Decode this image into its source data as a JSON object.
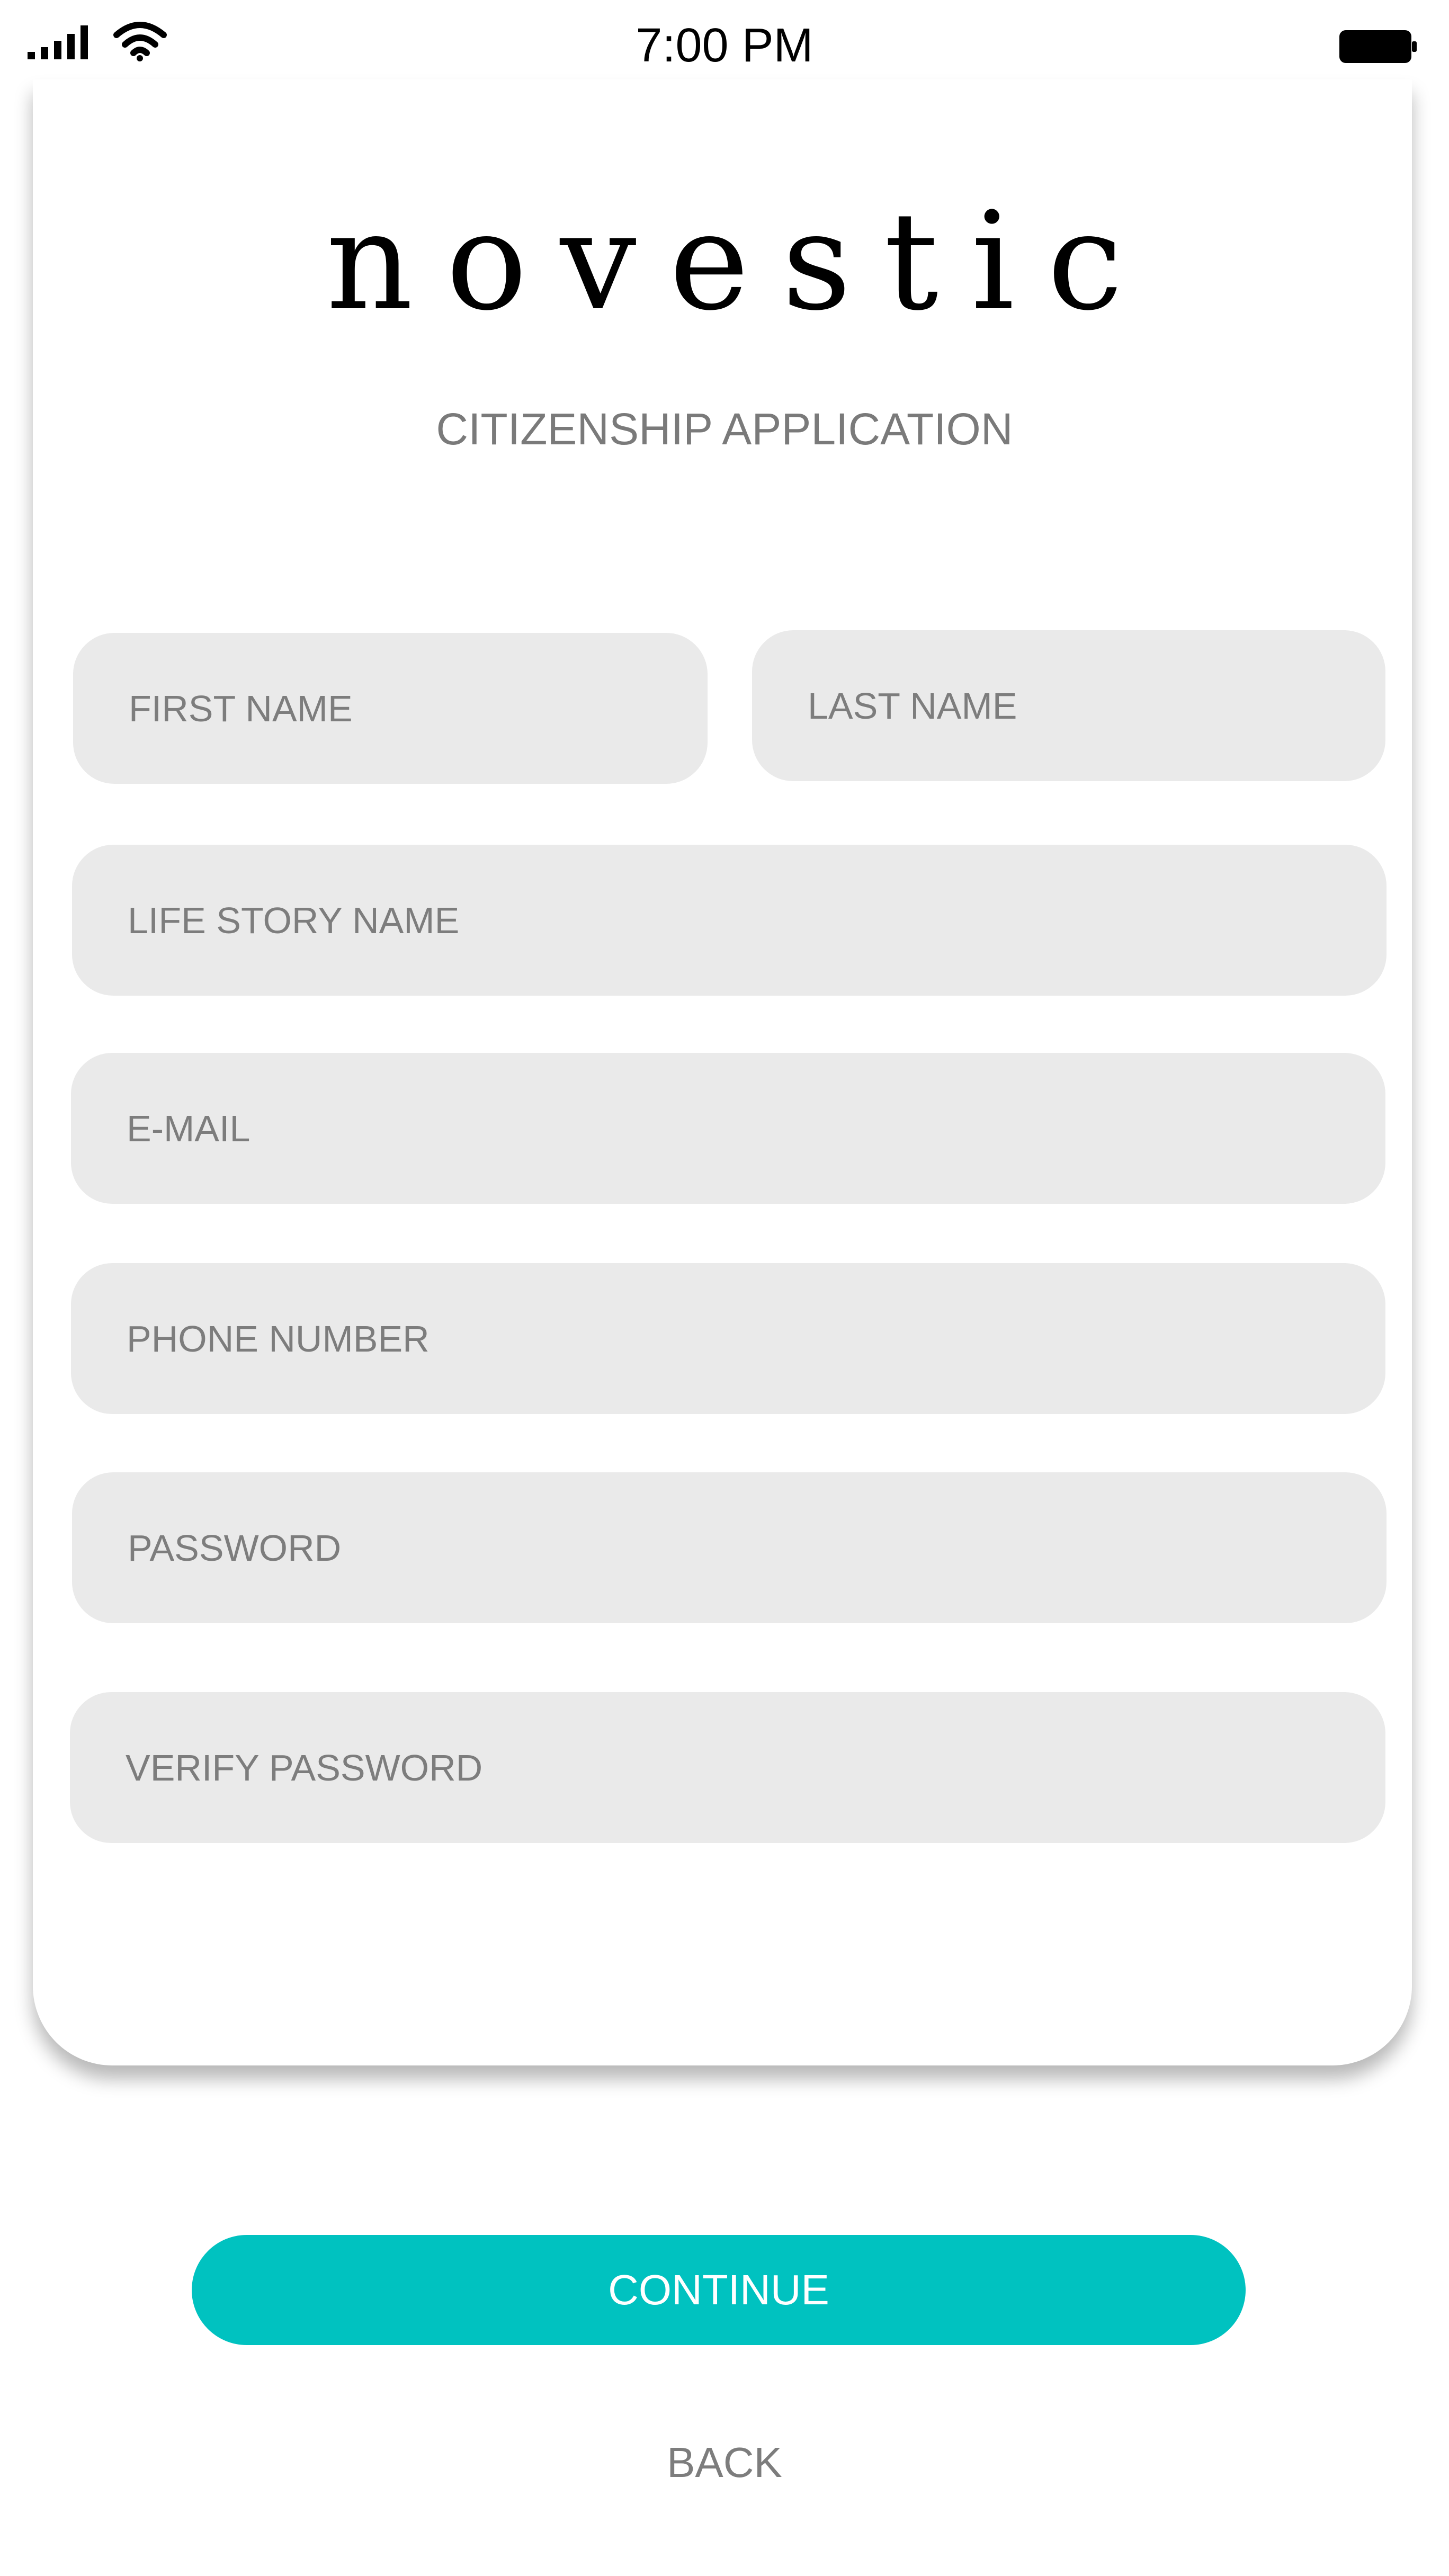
{
  "status_bar": {
    "time": "7:00 PM",
    "signal_icon": "cellular-signal-icon",
    "wifi_icon": "wifi-icon",
    "battery_icon": "battery-icon"
  },
  "brand": {
    "logo_text": "novestic"
  },
  "form": {
    "title": "CITIZENSHIP APPLICATION",
    "fields": {
      "first_name": {
        "placeholder": "FIRST NAME",
        "value": ""
      },
      "last_name": {
        "placeholder": "LAST NAME",
        "value": ""
      },
      "life_story_name": {
        "placeholder": "LIFE STORY NAME",
        "value": ""
      },
      "email": {
        "placeholder": "E-MAIL",
        "value": ""
      },
      "phone_number": {
        "placeholder": "PHONE NUMBER",
        "value": ""
      },
      "password": {
        "placeholder": "PASSWORD",
        "value": ""
      },
      "verify_password": {
        "placeholder": "VERIFY PASSWORD",
        "value": ""
      }
    }
  },
  "actions": {
    "continue_label": "CONTINUE",
    "back_label": "BACK"
  },
  "colors": {
    "accent": "#00c2c0",
    "field_background": "#eaeaea",
    "placeholder_text": "#7d7d7d",
    "subtitle_text": "#7a7a7a"
  }
}
